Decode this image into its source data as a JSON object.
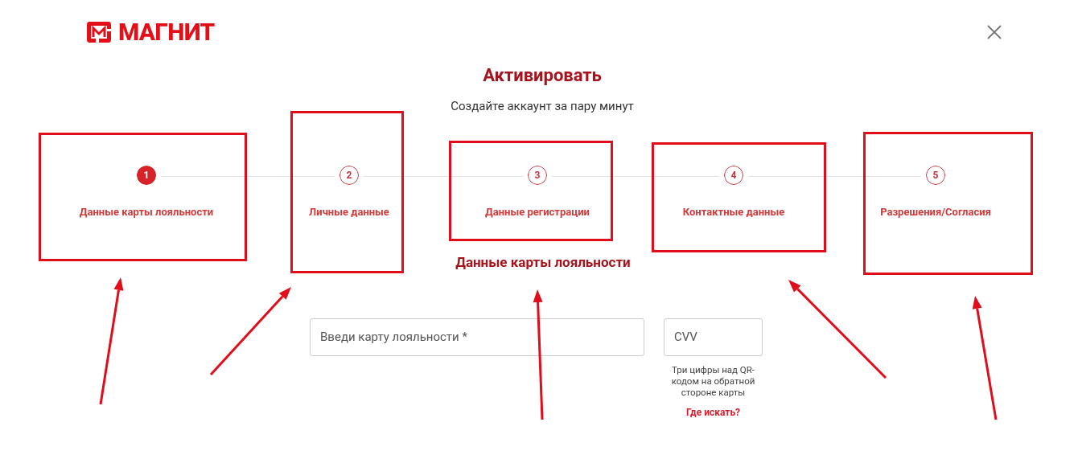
{
  "logo": {
    "text": "МАГНИТ"
  },
  "title": "Активировать",
  "subtitle": "Создайте аккаунт за пару минут",
  "steps": [
    {
      "number": "1",
      "label": "Данные карты лояльности",
      "selected": true,
      "highlighted": true
    },
    {
      "number": "2",
      "label": "Личные данные",
      "selected": false,
      "highlighted": true
    },
    {
      "number": "3",
      "label": "Данные регистрации",
      "selected": false,
      "highlighted": true
    },
    {
      "number": "4",
      "label": "Контактные данные",
      "selected": false,
      "highlighted": true
    },
    {
      "number": "5",
      "label": "Разрешения/Согласия",
      "selected": false,
      "highlighted": true
    }
  ],
  "section_title": "Данные карты лояльности",
  "card_field": {
    "placeholder": "Введи карту лояльности *"
  },
  "cvv_field": {
    "placeholder": "CVV",
    "hint": "Три цифры над QR-кодом на обратной стороне карты",
    "help_link": "Где искать?"
  }
}
